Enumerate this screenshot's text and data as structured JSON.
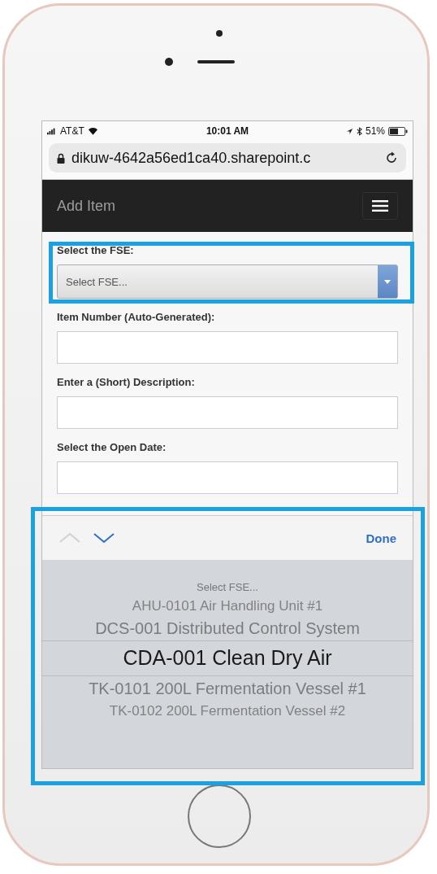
{
  "status_bar": {
    "carrier": "AT&T",
    "time": "10:01 AM",
    "battery": "51%"
  },
  "address_bar": {
    "url": "dikuw-4642a56ed1ca40.sharepoint.c"
  },
  "nav": {
    "title": "Add Item"
  },
  "form": [
    {
      "kind": "select",
      "label": "Select the FSE:",
      "placeholder": "Select FSE..."
    },
    {
      "kind": "text",
      "label": "Item Number (Auto-Generated):"
    },
    {
      "kind": "text",
      "label": "Enter a (Short) Description:"
    },
    {
      "kind": "text",
      "label": "Select the Open Date:"
    }
  ],
  "accessory": {
    "previous_disabled": true,
    "next_disabled": false,
    "done": "Done"
  },
  "picker": {
    "options": [
      {
        "label": "Select FSE...",
        "selected": false
      },
      {
        "label": "AHU-0101 Air Handling Unit #1",
        "selected": false
      },
      {
        "label": "DCS-001 Distributed Control System",
        "selected": false
      },
      {
        "label": "CDA-001 Clean Dry Air",
        "selected": true
      },
      {
        "label": "TK-0101 200L Fermentation Vessel #1",
        "selected": false
      },
      {
        "label": "TK-0102 200L Fermentation Vessel #2",
        "selected": false
      }
    ]
  }
}
